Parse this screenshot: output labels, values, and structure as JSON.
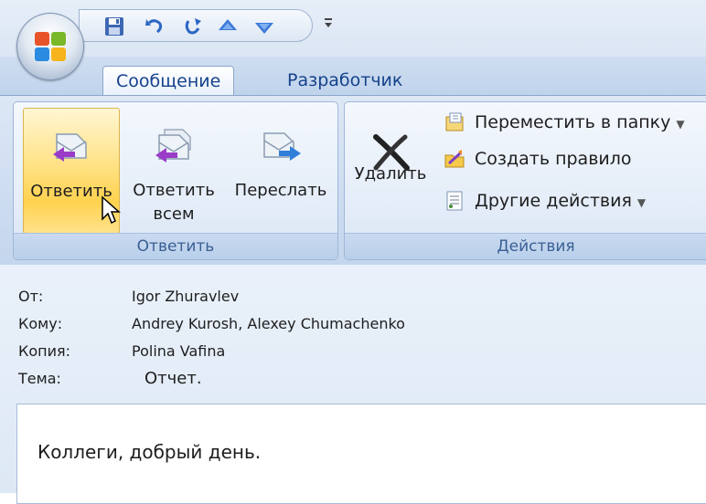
{
  "tabs": [
    {
      "label": "Сообщение",
      "active": true
    },
    {
      "label": "Разработчик",
      "active": false
    }
  ],
  "ribbon": {
    "respond_group": {
      "label": "Ответить",
      "buttons": [
        {
          "label": "Ответить",
          "icon": "reply-icon"
        },
        {
          "label": "Ответить\nвсем",
          "icon": "reply-all-icon"
        },
        {
          "label": "Переслать",
          "icon": "forward-icon"
        }
      ]
    },
    "actions_group": {
      "label": "Действия",
      "delete_label": "Удалить",
      "move_label": "Переместить в папку",
      "rule_label": "Создать правило",
      "other_label": "Другие действия"
    }
  },
  "header": {
    "from_label": "От:",
    "from_value": "Igor Zhuravlev",
    "to_label": "Кому:",
    "to_value": "Andrey Kurosh, Alexey Chumachenko",
    "cc_label": "Копия:",
    "cc_value": "Polina Vafina",
    "subject_label": "Тема:",
    "subject_value": "Отчет."
  },
  "body": {
    "text": "Коллеги, добрый день."
  },
  "colors": {
    "accent": "#15428b",
    "hover": "#ffd24f",
    "ribbon": "#cddcf0"
  }
}
